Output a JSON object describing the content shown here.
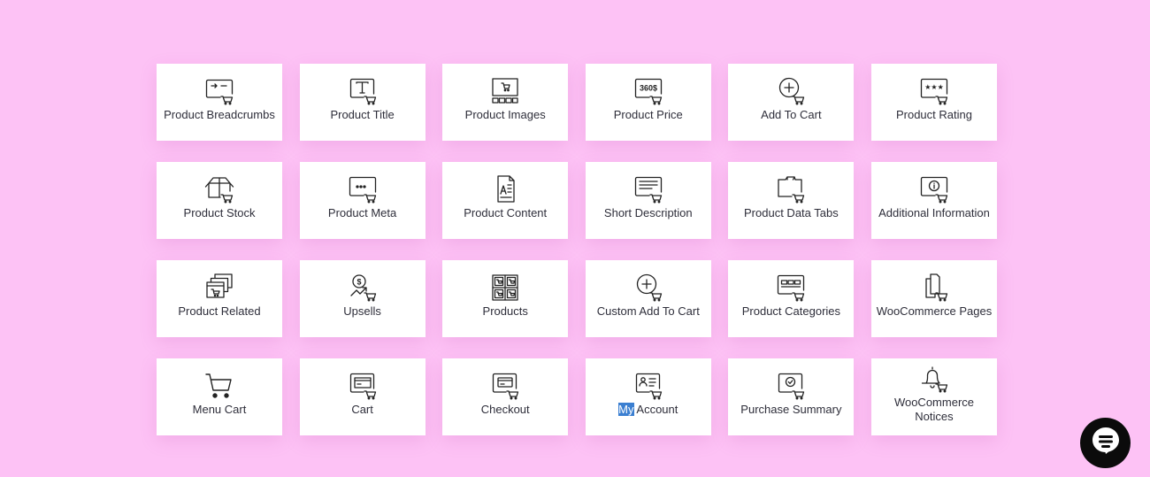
{
  "widgets": [
    {
      "label": "Product Breadcrumbs",
      "icon": "breadcrumbs-icon"
    },
    {
      "label": "Product Title",
      "icon": "title-icon"
    },
    {
      "label": "Product Images",
      "icon": "images-icon"
    },
    {
      "label": "Product Price",
      "icon": "price-icon",
      "icon_text": "360$"
    },
    {
      "label": "Add To Cart",
      "icon": "add-to-cart-icon"
    },
    {
      "label": "Product Rating",
      "icon": "rating-icon"
    },
    {
      "label": "Product Stock",
      "icon": "stock-icon"
    },
    {
      "label": "Product Meta",
      "icon": "meta-icon"
    },
    {
      "label": "Product Content",
      "icon": "content-icon"
    },
    {
      "label": "Short Description",
      "icon": "short-description-icon"
    },
    {
      "label": "Product Data Tabs",
      "icon": "data-tabs-icon"
    },
    {
      "label": "Additional Information",
      "icon": "additional-info-icon"
    },
    {
      "label": "Product Related",
      "icon": "related-icon"
    },
    {
      "label": "Upsells",
      "icon": "upsells-icon"
    },
    {
      "label": "Products",
      "icon": "products-icon"
    },
    {
      "label": "Custom Add To Cart",
      "icon": "custom-add-to-cart-icon"
    },
    {
      "label": "Product Categories",
      "icon": "categories-icon"
    },
    {
      "label": "WooCommerce Pages",
      "icon": "pages-icon"
    },
    {
      "label": "Menu Cart",
      "icon": "menu-cart-icon"
    },
    {
      "label": "Cart",
      "icon": "cart-icon"
    },
    {
      "label": "Checkout",
      "icon": "checkout-icon"
    },
    {
      "label_selected": "My",
      "label_rest": " Account",
      "icon": "my-account-icon"
    },
    {
      "label": "Purchase Summary",
      "icon": "purchase-summary-icon"
    },
    {
      "label": "WooCommerce Notices",
      "icon": "notices-icon"
    }
  ],
  "colors": {
    "background": "#fdc2f5",
    "card": "#ffffff",
    "text": "#2e2e3a",
    "selection": "#3b7fd1",
    "chat_button": "#0b0b0b"
  },
  "chat": {
    "icon": "chat-icon"
  }
}
